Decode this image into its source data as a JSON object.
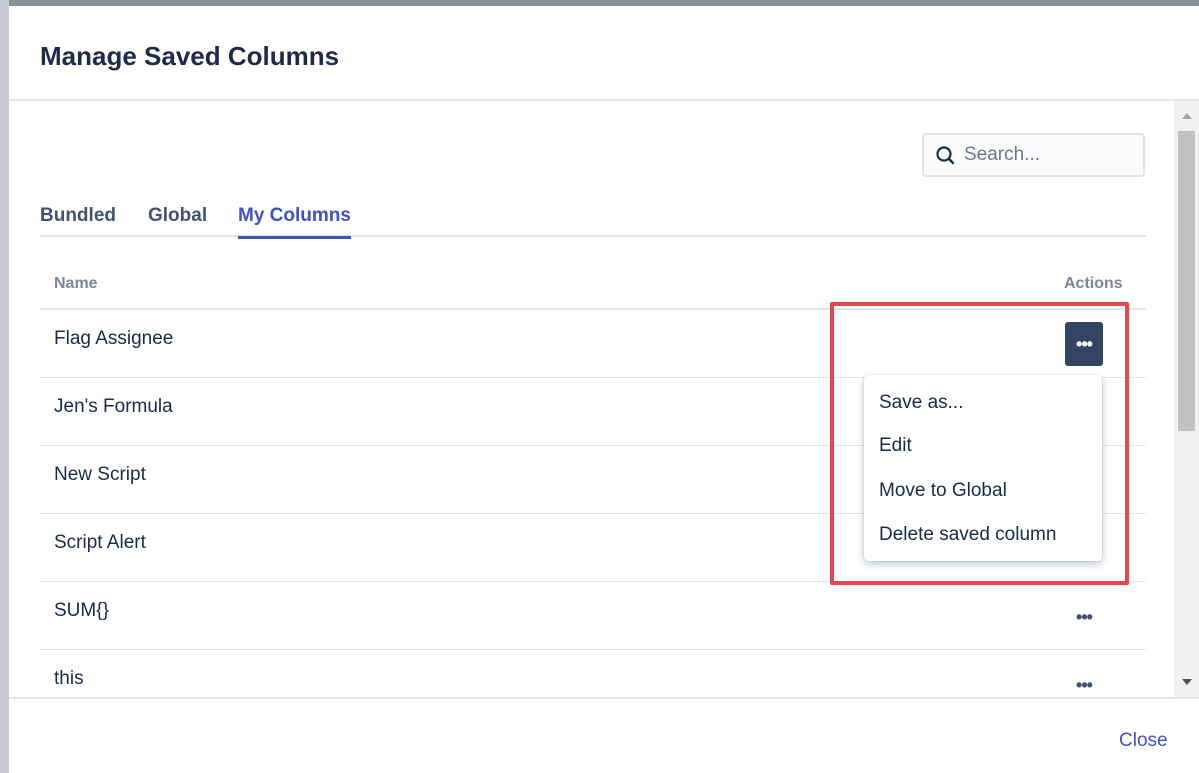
{
  "dialog": {
    "title": "Manage Saved Columns"
  },
  "search": {
    "placeholder": "Search...",
    "value": ""
  },
  "tabs": [
    {
      "label": "Bundled",
      "active": false
    },
    {
      "label": "Global",
      "active": false
    },
    {
      "label": "My Columns",
      "active": true
    }
  ],
  "table": {
    "headers": {
      "name": "Name",
      "actions": "Actions"
    },
    "rows": [
      {
        "name": "Flag Assignee",
        "actions_label": "•••"
      },
      {
        "name": "Jen's Formula",
        "actions_label": "•••"
      },
      {
        "name": "New Script",
        "actions_label": "•••"
      },
      {
        "name": "Script Alert",
        "actions_label": "•••"
      },
      {
        "name": "SUM{}",
        "actions_label": "•••"
      },
      {
        "name": "this",
        "actions_label": "•••"
      }
    ]
  },
  "menu": {
    "items": [
      "Save as...",
      "Edit",
      "Move to Global",
      "Delete saved column"
    ]
  },
  "footer": {
    "close_label": "Close"
  },
  "colors": {
    "accent": "#3e52c4",
    "title": "#1e2a4a",
    "highlight": "#e5484d",
    "active_button": "#344563"
  }
}
